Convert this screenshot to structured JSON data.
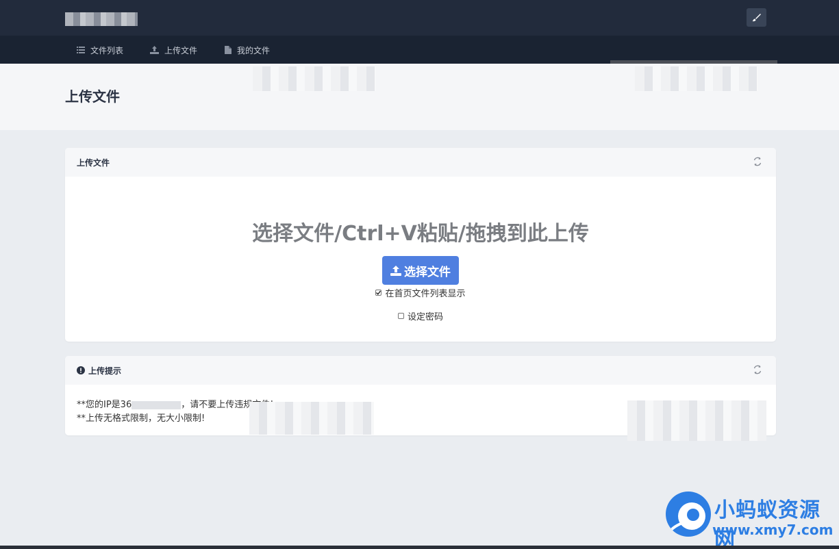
{
  "nav": {
    "items": [
      {
        "label": "文件列表",
        "icon": "list-icon"
      },
      {
        "label": "上传文件",
        "icon": "upload-icon"
      },
      {
        "label": "我的文件",
        "icon": "file-icon"
      }
    ]
  },
  "page": {
    "title": "上传文件"
  },
  "upload_card": {
    "title": "上传文件",
    "prompt": "选择文件/Ctrl+V粘贴/拖拽到此上传",
    "button_label": "选择文件",
    "show_on_home": {
      "label": "在首页文件列表显示",
      "checked": true
    },
    "set_password": {
      "label": "设定密码",
      "checked": false
    }
  },
  "tips_card": {
    "title": "上传提示",
    "line1_prefix": "**您的IP是36",
    "line1_suffix": "，请不要上传违规文件!",
    "line2": "**上传无格式限制，无大小限制!"
  },
  "watermark": {
    "name": "小蚂蚁资源网",
    "url": "www.xmy7.com"
  },
  "colors": {
    "accent": "#4f7fe0",
    "topbar": "#222b3c",
    "navbar": "#1a2332",
    "watermark": "#2d7ee3"
  }
}
